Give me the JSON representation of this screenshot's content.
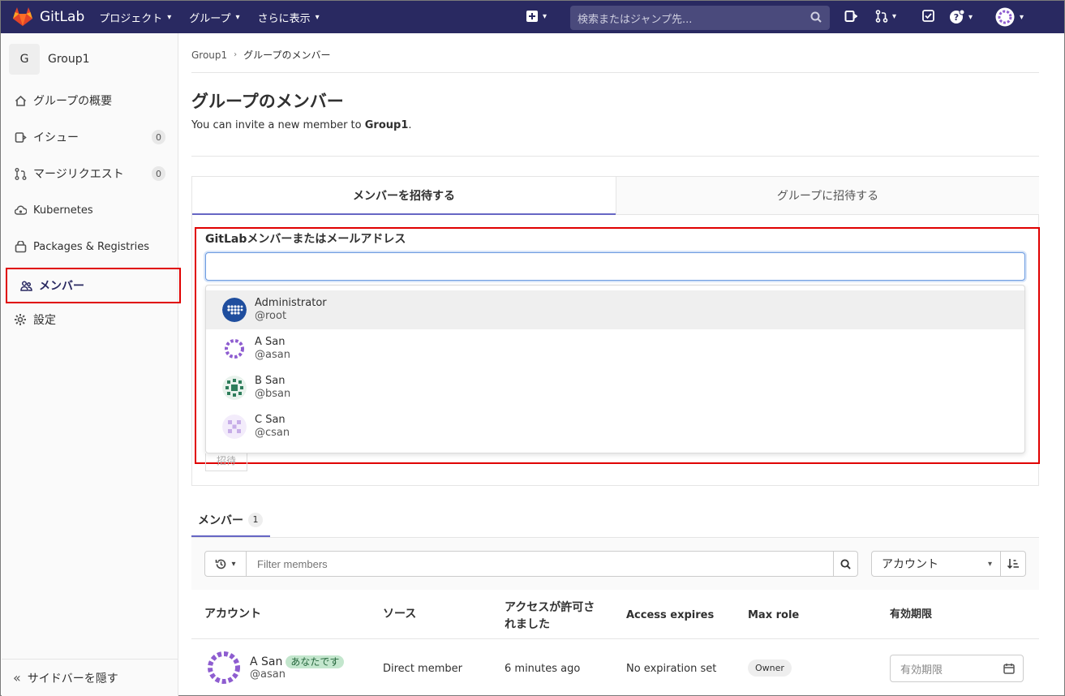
{
  "topbar": {
    "app_name": "GitLab",
    "nav": [
      "プロジェクト",
      "グループ",
      "さらに表示"
    ],
    "search_placeholder": "検索またはジャンプ先...",
    "accent": "#292961"
  },
  "sidebar": {
    "group_initial": "G",
    "group_name": "Group1",
    "items": [
      {
        "label": "グループの概要",
        "icon": "home-icon"
      },
      {
        "label": "イシュー",
        "icon": "issues-icon",
        "count": "0"
      },
      {
        "label": "マージリクエスト",
        "icon": "merge-request-icon",
        "count": "0"
      },
      {
        "label": "Kubernetes",
        "icon": "cloud-gear-icon"
      },
      {
        "label": "Packages & Registries",
        "icon": "package-icon"
      },
      {
        "label": "メンバー",
        "icon": "users-icon",
        "active": true
      },
      {
        "label": "設定",
        "icon": "gear-icon"
      }
    ],
    "collapse_label": "サイドバーを隠す"
  },
  "breadcrumb": {
    "parent": "Group1",
    "current": "グループのメンバー"
  },
  "page": {
    "title": "グループのメンバー",
    "subtitle_prefix": "You can invite a new member to ",
    "subtitle_group": "Group1",
    "subtitle_suffix": "."
  },
  "invite": {
    "tabs": [
      "メンバーを招待する",
      "グループに招待する"
    ],
    "field_label": "GitLabメンバーまたはメールアドレス",
    "field_value": "",
    "invite_button": "招待",
    "suggestions": [
      {
        "name": "Administrator",
        "username": "@root"
      },
      {
        "name": "A San",
        "username": "@asan"
      },
      {
        "name": "B San",
        "username": "@bsan"
      },
      {
        "name": "C San",
        "username": "@csan"
      }
    ]
  },
  "members": {
    "tab_label": "メンバー",
    "tab_count": "1",
    "filter_placeholder": "Filter members",
    "sort_value": "アカウント",
    "columns": [
      "アカウント",
      "ソース",
      "アクセスが許可されました",
      "Access expires",
      "Max role",
      "有効期限"
    ],
    "rows": [
      {
        "name": "A San",
        "badge": "あなたです",
        "username": "@asan",
        "source": "Direct member",
        "granted": "6 minutes ago",
        "expires": "No expiration set",
        "role": "Owner",
        "expiry_placeholder": "有効期限"
      }
    ]
  }
}
